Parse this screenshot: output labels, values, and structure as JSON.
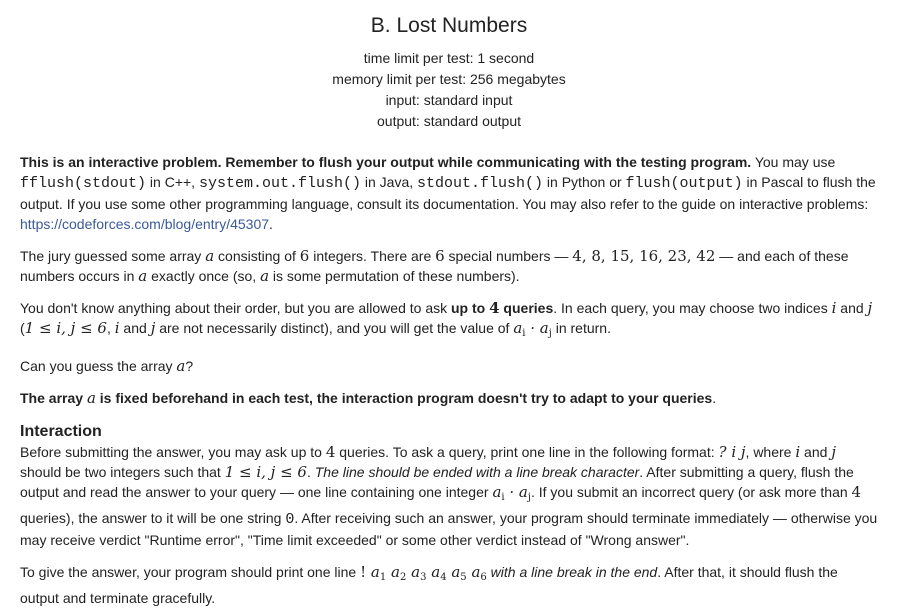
{
  "problem": {
    "title": "B. Lost Numbers",
    "time_limit": "time limit per test: 1 second",
    "memory_limit": "memory limit per test: 256 megabytes",
    "input": "input: standard input",
    "output": "output: standard output"
  },
  "p1": {
    "bold": "This is an interactive problem. Remember to flush your output while communicating with the testing program.",
    "t1": " You may use ",
    "code1": "fflush(stdout)",
    "t2": " in C++, ",
    "code2": "system.out.flush()",
    "t3": " in Java, ",
    "code3": "stdout.flush()",
    "t4": " in Python or ",
    "code4": "flush(output)",
    "t5": " in Pascal to flush the output. If you use some other programming language, consult its documentation. You may also refer to the guide on interactive problems: ",
    "link": "https://codeforces.com/blog/entry/45307",
    "t6": "."
  },
  "p2": {
    "t1": "The jury guessed some array ",
    "m1": "a",
    "t2": " consisting of ",
    "m2": "6",
    "t3": " integers. There are ",
    "m3": "6",
    "t4": " special numbers — ",
    "m4": "4, 8, 15, 16, 23, 42",
    "t5": " — and each of these numbers occurs in ",
    "m5": "a",
    "t6": " exactly once (so, ",
    "m6": "a",
    "t7": " is some permutation of these numbers)."
  },
  "p3": {
    "t1": "You don't know anything about their order, but you are allowed to ask ",
    "b1": "up to ",
    "bm": "4",
    "b2": " queries",
    "t2": ". In each query, you may choose two indices ",
    "m1": "i",
    "t3": " and ",
    "m2": "j",
    "t4": " (",
    "m3": "1 ≤ i, j ≤ 6",
    "t5": ", ",
    "m4": "i",
    "t6": " and ",
    "m5": "j",
    "t7": " are not necessarily distinct), and you will get the value of ",
    "m6": "a",
    "s6": "i",
    "m7": " · a",
    "s7": "j",
    "t8": " in return."
  },
  "p4": {
    "t1": "Can you guess the array ",
    "m1": "a",
    "t2": "?"
  },
  "p5": {
    "b1": "The array ",
    "m1": "a",
    "b2": " is fixed beforehand in each test, the interaction program doesn't try to adapt to your queries",
    "t1": "."
  },
  "interaction": {
    "title": "Interaction",
    "p1": {
      "t1": "Before submitting the answer, you may ask up to ",
      "m1": "4",
      "t2": " queries. To ask a query, print one line in the following format: ",
      "m2": "? i j",
      "t3": ", where ",
      "m3": "i",
      "t4": " and ",
      "m4": "j",
      "t5": " should be two integers such that ",
      "m5": "1 ≤ i, j ≤ 6",
      "t6": ". ",
      "it1": "The line should be ended with a line break character",
      "t7": ". After submitting a query, flush the output and read the answer to your query — one line containing one integer ",
      "m6": "a",
      "s6": "i",
      "m7": " · a",
      "s7": "j",
      "t8": ". If you submit an incorrect query (or ask more than ",
      "m8": "4",
      "t9": " queries), the answer to it will be one string ",
      "code1": "0",
      "t10": ". After receiving such an answer, your program should terminate immediately — otherwise you may receive verdict \"Runtime error\", \"Time limit exceeded\" or some other verdict instead of \"Wrong answer\"."
    },
    "p2": {
      "t1": "To give the answer, your program should print one line ",
      "m1": "!",
      "terms": [
        "a",
        "a",
        "a",
        "a",
        "a",
        "a"
      ],
      "subs": [
        "1",
        "2",
        "3",
        "4",
        "5",
        "6"
      ],
      "it1": " with a line break in the end",
      "t2": ". After that, it should flush the output and terminate gracefully."
    }
  }
}
